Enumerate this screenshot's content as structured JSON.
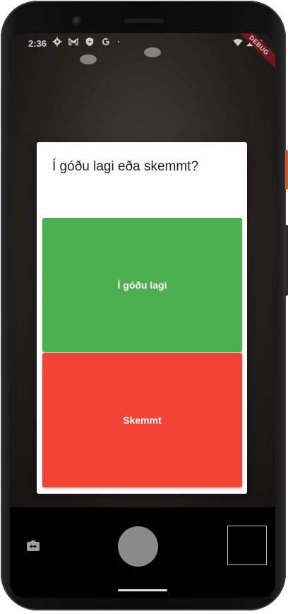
{
  "statusbar": {
    "time": "2:36",
    "icons_left": [
      "gear-icon",
      "gmail-icon",
      "shield-icon",
      "google-icon",
      "dot-icon"
    ],
    "icons_right": [
      "wifi-icon",
      "signal-icon",
      "battery-icon"
    ],
    "debug_banner": "DEBUG"
  },
  "dialog": {
    "title": "Í góðu lagi eða skemmt?",
    "good_label": "Í góðu lagi",
    "bad_label": "Skemmt"
  },
  "camera": {
    "controls": [
      "flip-camera-icon",
      "shutter-button",
      "last-photo-thumbnail"
    ]
  },
  "colors": {
    "good": "#4caf50",
    "bad": "#f44336",
    "dialog_bg": "#ffffff",
    "debug_ribbon": "#8e1c2a"
  }
}
